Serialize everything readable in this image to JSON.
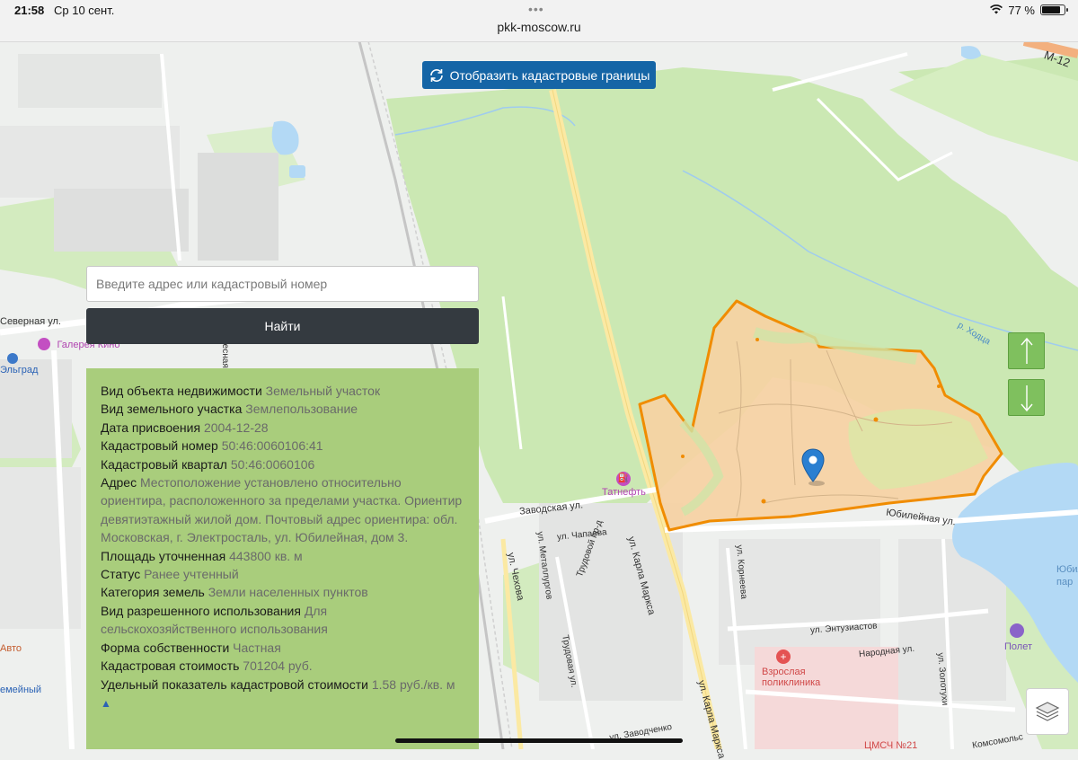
{
  "status_bar": {
    "time": "21:58",
    "date": "Ср 10 сент.",
    "url": "pkk-moscow.ru",
    "battery": "77 %"
  },
  "toolbar": {
    "boundaries_button": "Отобразить кадастровые границы"
  },
  "search": {
    "placeholder": "Введите адрес или кадастровый номер",
    "button": "Найти"
  },
  "info_panel": {
    "rows": [
      {
        "key": "Вид объекта недвижимости",
        "value": "Земельный участок"
      },
      {
        "key": "Вид земельного участка",
        "value": "Землепользование"
      },
      {
        "key": "Дата присвоения",
        "value": "2004-12-28"
      },
      {
        "key": "Кадастровый номер",
        "value": "50:46:0060106:41"
      },
      {
        "key": "Кадастровый квартал",
        "value": "50:46:0060106"
      },
      {
        "key": "Адрес",
        "value": "Местоположение установлено относительно ориентира, расположенного за пределами участка. Ориентир девятиэтажный жилой дом. Почтовый адрес ориентира: обл. Московская, г. Электросталь, ул. Юбилейная, дом 3."
      },
      {
        "key": "Площадь уточненная",
        "value": "443800 кв. м"
      },
      {
        "key": "Статус",
        "value": "Ранее учтенный"
      },
      {
        "key": "Категория земель",
        "value": "Земли населенных пунктов"
      },
      {
        "key": "Вид разрешенного использования",
        "value": "Для сельскохозяйственного использования"
      },
      {
        "key": "Форма собственности",
        "value": "Частная"
      },
      {
        "key": "Кадастровая стоимость",
        "value": "701204 руб."
      },
      {
        "key": "Удельный показатель кадастровой стоимости",
        "value": "1.58 руб./кв. м"
      }
    ],
    "collapse_glyph": "▲"
  },
  "map": {
    "road_labels": {
      "severnaya": "Северная ул.",
      "zavodskaya": "Заводская ул.",
      "karla_marksa_1": "ул. Карла Маркса",
      "karla_marksa_2": "ул. Карла Маркса",
      "chekhova": "ул. Чехова",
      "metallurgov": "ул. Металлургов",
      "chapaeva": "ул. Чапаева",
      "trudovoy_pr": "Трудовой пр-д",
      "trudovaya": "Трудовая ул.",
      "korneeva": "ул. Корнеева",
      "yubileynaya": "Юбилейная ул.",
      "entuziastov": "ул. Энтузиастов",
      "narodnaya": "Народная ул.",
      "zolotukhi": "ул. Золотухи",
      "komsomolskaya": "Комсомольс",
      "zavodchenko": "ул. Заводченко",
      "river": "р. Ходца",
      "highway": "М-12",
      "vasnaya": "Весная",
      "auto": "Авто",
      "zemeyny": "емейный",
      "ubil": "Юбил",
      "ubil2": "пар",
      "umsch": "ЦМСЧ №21"
    },
    "poi": {
      "galereya": "Галерея Кино",
      "elgrad": "Эльград",
      "tatneft": "Татнефть",
      "clinic_1": "Взрослая",
      "clinic_2": "поликлиника",
      "polet": "Полет"
    },
    "colors": {
      "green": "#cbe8b3",
      "parcel_fill": "#f6d1a3",
      "parcel_stroke": "#f08c00",
      "water": "#b3d9f5",
      "button_blue": "#1565a6",
      "panel_green": "#a9cd7c",
      "nav_green": "#7fc05e"
    },
    "icons": [
      "location-pin-icon",
      "arrow-up-icon",
      "arrow-down-icon",
      "layers-icon",
      "refresh-icon",
      "wifi-icon",
      "battery-icon"
    ]
  }
}
